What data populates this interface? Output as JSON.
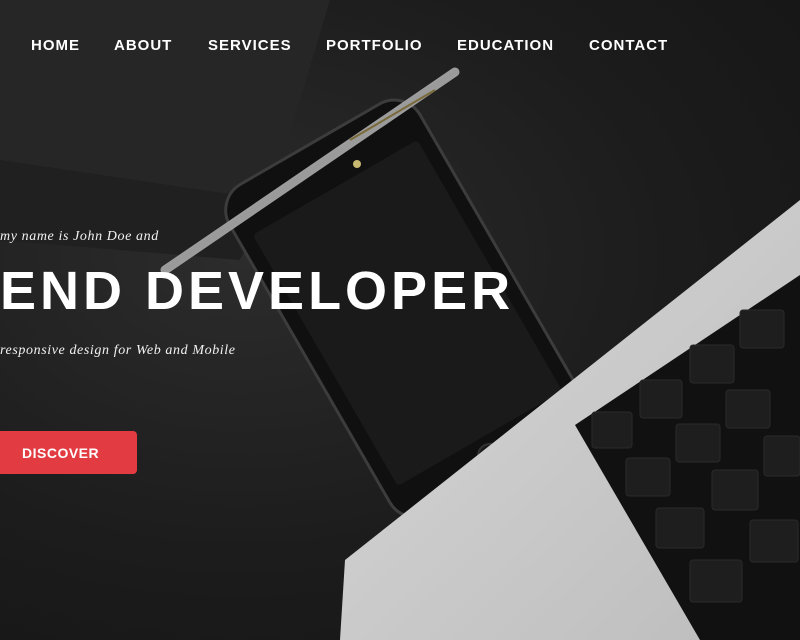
{
  "nav": {
    "items": [
      {
        "label": "HOME"
      },
      {
        "label": "ABOUT"
      },
      {
        "label": "SERVICES"
      },
      {
        "label": "PORTFOLIO"
      },
      {
        "label": "EDUCATION"
      },
      {
        "label": "CONTACT"
      }
    ]
  },
  "hero": {
    "intro": "my name is John Doe and",
    "title": "END DEVELOPER",
    "subtitle": "responsive design for Web and Mobile",
    "cta_label": "DISCOVER"
  },
  "colors": {
    "accent": "#e33b42",
    "background": "#1e1e1e",
    "text": "#ffffff"
  },
  "icons": {
    "keyboard_keys": [
      "fn",
      "esc",
      "tab",
      "ctrl",
      "option",
      "cmd"
    ]
  }
}
